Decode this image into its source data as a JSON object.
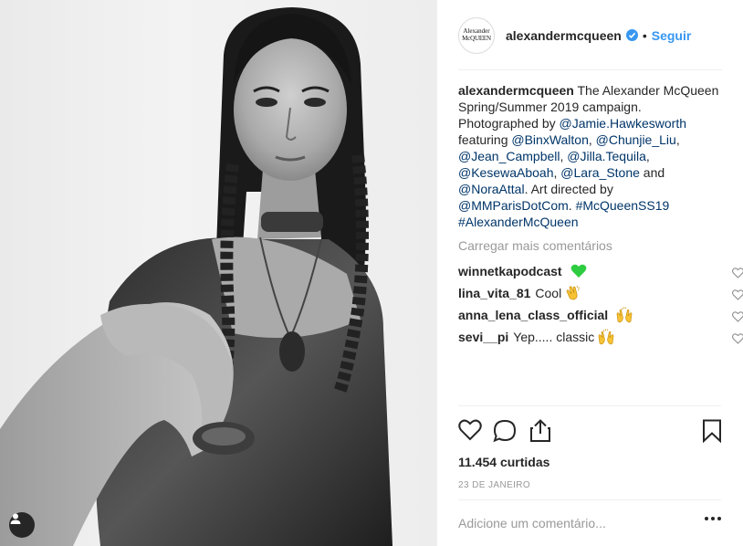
{
  "account": {
    "username": "alexandermcqueen",
    "avatar_line1": "Alexander",
    "avatar_line2": "McQUEEN",
    "separator": "•",
    "follow_label": "Seguir"
  },
  "caption": {
    "username": "alexandermcqueen",
    "segments": [
      {
        "text": " The Alexander McQueen Spring/Summer 2019 campaign. Photographed by ",
        "mention": false
      },
      {
        "text": "@Jamie.Hawkesworth",
        "mention": true
      },
      {
        "text": " featuring ",
        "mention": false
      },
      {
        "text": "@BinxWalton",
        "mention": true
      },
      {
        "text": ", ",
        "mention": false
      },
      {
        "text": "@Chunjie_Liu",
        "mention": true
      },
      {
        "text": ", ",
        "mention": false
      },
      {
        "text": "@Jean_Campbell",
        "mention": true
      },
      {
        "text": ", ",
        "mention": false
      },
      {
        "text": "@Jilla.Tequila",
        "mention": true
      },
      {
        "text": ", ",
        "mention": false
      },
      {
        "text": "@KesewaAboah",
        "mention": true
      },
      {
        "text": ", ",
        "mention": false
      },
      {
        "text": "@Lara_Stone",
        "mention": true
      },
      {
        "text": " and ",
        "mention": false
      },
      {
        "text": "@NoraAttal",
        "mention": true
      },
      {
        "text": ". Art directed by ",
        "mention": false
      },
      {
        "text": "@MMParisDotCom",
        "mention": true
      },
      {
        "text": ". ",
        "mention": false
      },
      {
        "text": "#McQueenSS19",
        "mention": true
      },
      {
        "text": " ",
        "mention": false
      },
      {
        "text": "#AlexanderMcQueen",
        "mention": true
      }
    ]
  },
  "load_more_label": "Carregar mais comentários",
  "comments": [
    {
      "user": "winnetkapodcast",
      "text": "",
      "emoji": "green-heart"
    },
    {
      "user": "lina_vita_81",
      "text": "Cool",
      "emoji": "clapping-hands"
    },
    {
      "user": "anna_lena_class_official",
      "text": "",
      "emoji": "raising-hands"
    },
    {
      "user": "sevi__pi",
      "text": "Yep..... classic",
      "emoji": "raising-hands"
    }
  ],
  "likes_label": "11.454 curtidas",
  "date_label": "23 DE JANEIRO",
  "add_comment_placeholder": "Adicione um comentário...",
  "colors": {
    "link": "#003569",
    "follow": "#3897f0",
    "verified": "#3897f0",
    "muted": "#999999",
    "text": "#262626"
  },
  "icons": {
    "like": "heart-outline-icon",
    "comment": "comment-bubble-icon",
    "share": "share-upload-icon",
    "save": "bookmark-icon",
    "more": "more-dots-icon",
    "verified": "verified-badge-icon",
    "account": "user-account-icon"
  }
}
